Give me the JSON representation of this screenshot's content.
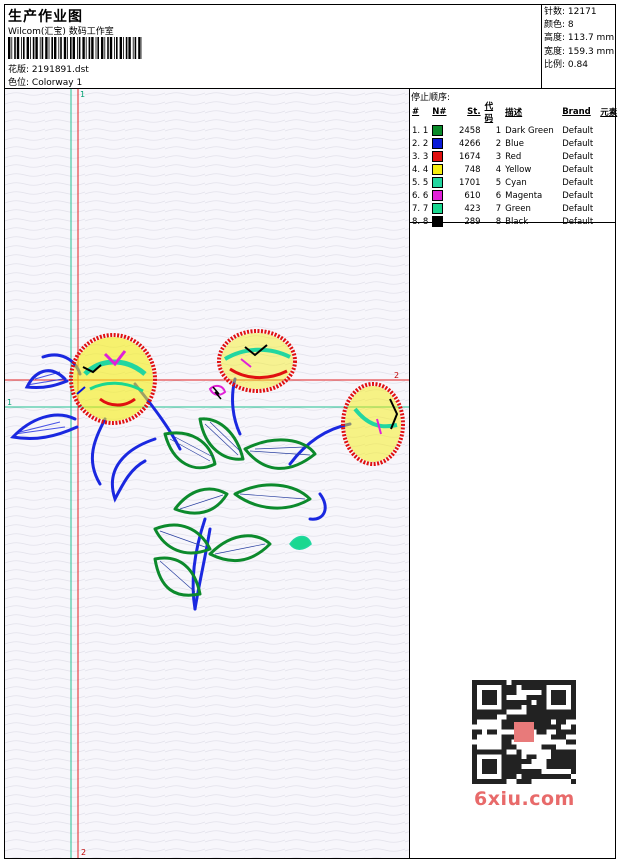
{
  "header": {
    "title": "生产作业图",
    "company": "Wilcom(汇宝) 数码工作室",
    "pattern_label": "花版:",
    "pattern_value": "2191891.dst",
    "colorway_label": "色位:",
    "colorway_value": "Colorway 1"
  },
  "stats": {
    "stitches_label": "针数:",
    "stitches_value": "12171",
    "colors_label": "颜色:",
    "colors_value": "8",
    "height_label": "高度:",
    "height_value": "113.7 mm",
    "width_label": "宽度:",
    "width_value": "159.3 mm",
    "scale_label": "比例:",
    "scale_value": "0.84"
  },
  "stop_sequence": {
    "title": "停止顺序:",
    "columns": [
      "#",
      "N#",
      "St.",
      "代码",
      "描述",
      "Brand",
      "元素"
    ],
    "rows": [
      {
        "idx": "1.",
        "n": "1",
        "color": "#0a8a2a",
        "st": "2458",
        "code": "1",
        "desc": "Dark Green",
        "brand": "Default"
      },
      {
        "idx": "2.",
        "n": "2",
        "color": "#0a1ad8",
        "st": "4266",
        "code": "2",
        "desc": "Blue",
        "brand": "Default"
      },
      {
        "idx": "3.",
        "n": "3",
        "color": "#e01010",
        "st": "1674",
        "code": "3",
        "desc": "Red",
        "brand": "Default"
      },
      {
        "idx": "4.",
        "n": "4",
        "color": "#f5ee10",
        "st": "748",
        "code": "4",
        "desc": "Yellow",
        "brand": "Default"
      },
      {
        "idx": "5.",
        "n": "5",
        "color": "#22d6a0",
        "st": "1701",
        "code": "5",
        "desc": "Cyan",
        "brand": "Default"
      },
      {
        "idx": "6.",
        "n": "6",
        "color": "#e020d8",
        "st": "610",
        "code": "6",
        "desc": "Magenta",
        "brand": "Default"
      },
      {
        "idx": "7.",
        "n": "7",
        "color": "#1ad890",
        "st": "423",
        "code": "7",
        "desc": "Green",
        "brand": "Default"
      },
      {
        "idx": "8.",
        "n": "8",
        "color": "#000000",
        "st": "289",
        "code": "8",
        "desc": "Black",
        "brand": "Default"
      }
    ]
  },
  "canvas": {
    "marker_top": "1",
    "marker_h_red": "2",
    "marker_h_green": "1",
    "marker_bottom": "2"
  },
  "watermark": "6xiu.com"
}
